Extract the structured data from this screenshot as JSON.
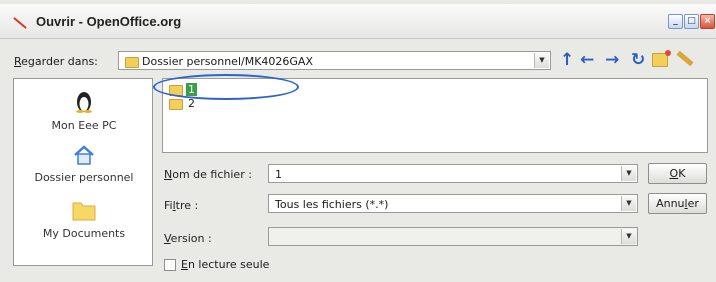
{
  "window": {
    "title": "Ouvrir - OpenOffice.org"
  },
  "lookin": {
    "label": "Regarder dans:",
    "accesskey": "R",
    "rest": "egarder dans:",
    "path": "Dossier personnel/MK4026GAX"
  },
  "nav_icons": [
    "up-arrow-icon",
    "back-arrow-icon",
    "forward-arrow-icon",
    "refresh-icon",
    "new-folder-icon",
    "tools-icon"
  ],
  "places": [
    {
      "label": "Mon Eee PC",
      "icon": "penguin-icon"
    },
    {
      "label": "Dossier personnel",
      "icon": "home-icon"
    },
    {
      "label": "My Documents",
      "icon": "folder-icon"
    }
  ],
  "files": [
    {
      "name": "1",
      "selected": true
    },
    {
      "name": "2",
      "selected": false
    }
  ],
  "form": {
    "filename_label_key": "N",
    "filename_label_rest": "om de fichier :",
    "filename_value": "1",
    "filter_label_a": "Fi",
    "filter_label_key": "l",
    "filter_label_b": "tre :",
    "filter_value": "Tous les fichiers (*.*)",
    "version_label_key": "V",
    "version_label_rest": "ersion :",
    "version_value": "",
    "readonly_key": "E",
    "readonly_rest": "n lecture seule"
  },
  "buttons": {
    "ok_key": "O",
    "ok_rest": "K",
    "cancel_a": "Annu",
    "cancel_key": "l",
    "cancel_b": "er"
  },
  "colors": {
    "selection": "#3b9c4a",
    "highlight_ellipse": "#2c64cf",
    "folder": "#f2cf58"
  }
}
